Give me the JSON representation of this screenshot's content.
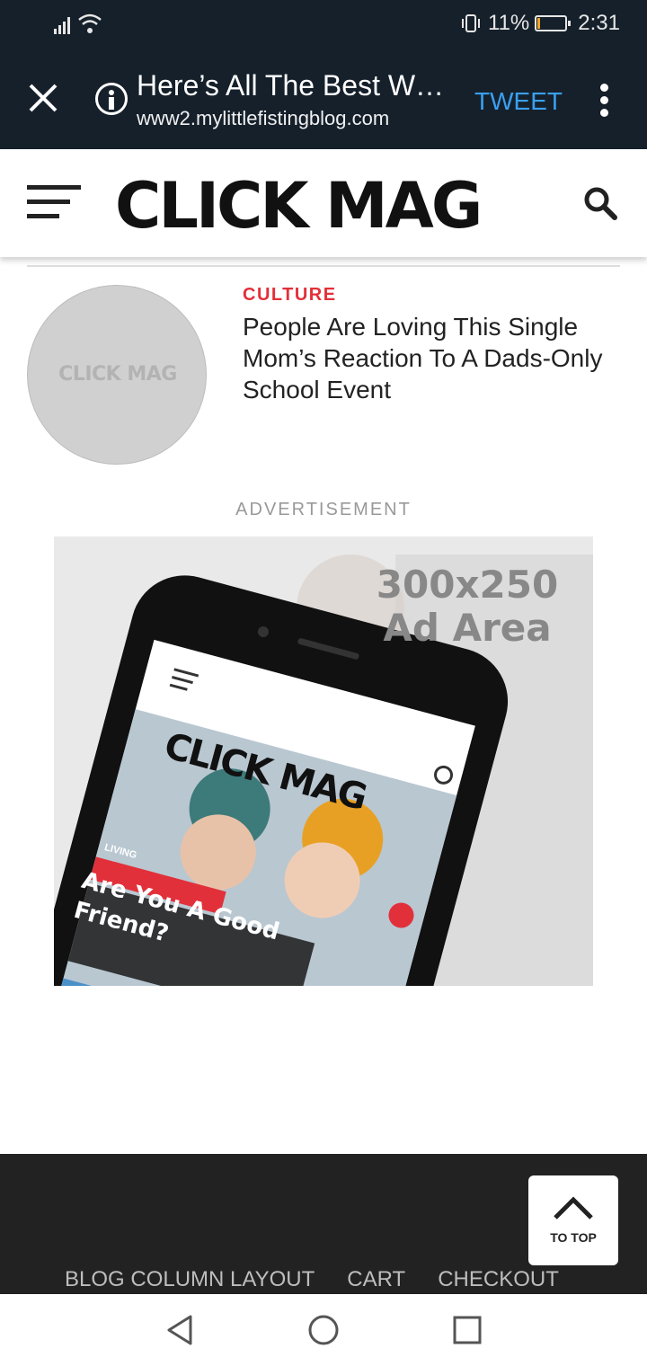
{
  "status_bar": {
    "battery": "11%",
    "time": "2:31",
    "battery_level": 0.11,
    "battery_color": "#f5a623"
  },
  "browser": {
    "title": "Here’s All The Best W…",
    "url": "www2.mylittlefistingblog.com",
    "tweet_label": "TWEET"
  },
  "site": {
    "logo": "CLICK MAG"
  },
  "article": {
    "thumb_text": "CLICK MAG",
    "category": "CULTURE",
    "headline": "People Are Loving This Single Mom’s Reaction To A Dads-Only School Event"
  },
  "ad": {
    "label": "ADVERTISEMENT",
    "size_text": "300x250",
    "area_text": "Ad Area",
    "phone_logo": "CLICK MAG",
    "phone_tag": "LIVING",
    "phone_headline_1": "Are You A Good",
    "phone_headline_2": "Friend?"
  },
  "footer": {
    "links": [
      "BLOG COLUMN LAYOUT",
      "CART",
      "CHECKOUT"
    ],
    "to_top": "TO TOP"
  },
  "colors": {
    "accent": "#e2303a",
    "tweet": "#3aa0f0",
    "bar": "#15202b"
  }
}
